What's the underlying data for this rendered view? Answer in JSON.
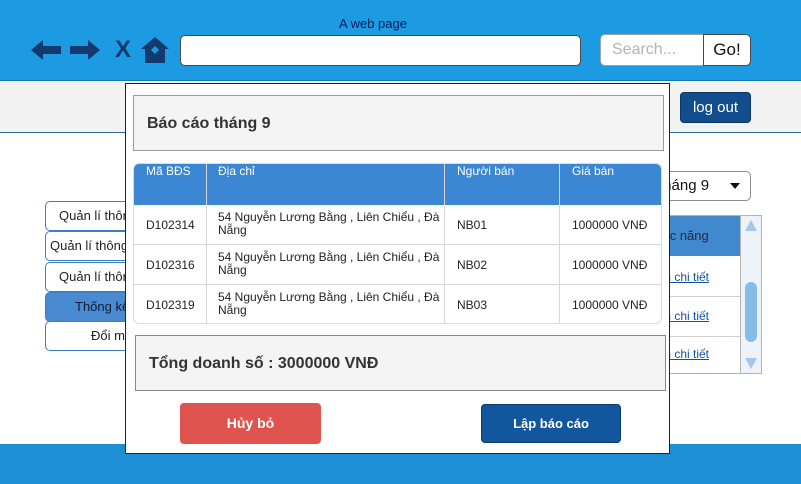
{
  "browser": {
    "page_title": "A web page",
    "url": "",
    "search_placeholder": "Search...",
    "go_label": "Go!",
    "icons": {
      "back": "arrow-left-icon",
      "forward": "arrow-right-icon",
      "stop": "close-icon",
      "home": "home-icon"
    },
    "stop_glyph": "X"
  },
  "header": {
    "logout_label": "log out"
  },
  "sidebar": {
    "items": [
      {
        "label": "Quản lí thôn"
      },
      {
        "label": "Quản lí thông"
      },
      {
        "label": "Quản lí thôn"
      },
      {
        "label": "Thống kê"
      },
      {
        "label": "Đổi mậ"
      }
    ],
    "active_index": 3
  },
  "background_panel": {
    "month_select_value": "tháng 9",
    "table_header": "ức năng",
    "links": [
      "m chi tiết",
      "m chi tiết",
      "m chi tiết"
    ]
  },
  "modal": {
    "title": "Báo cáo tháng 9",
    "columns": [
      "Mã BĐS",
      "Địa chỉ",
      "Người bán",
      "Giá bán"
    ],
    "rows": [
      {
        "code": "D102314",
        "address": "54 Nguyễn Lương Bằng , Liên Chiểu , Đà Nẵng",
        "seller": "NB01",
        "price": "1000000 VNĐ"
      },
      {
        "code": "D102316",
        "address": "54 Nguyễn Lương Bằng , Liên Chiểu , Đà Nẵng",
        "seller": "NB02",
        "price": "1000000 VNĐ"
      },
      {
        "code": "D102319",
        "address": "54 Nguyễn Lương Bằng , Liên Chiểu , Đà Nẵng",
        "seller": "NB03",
        "price": "1000000 VNĐ"
      }
    ],
    "total_text": "Tổng doanh số : 3000000 VNĐ",
    "cancel_label": "Hủy bỏ",
    "create_label": "Lập báo cáo"
  },
  "colors": {
    "chrome": "#1d9be2",
    "primary_button": "#12569d",
    "cancel_button": "#e0544f",
    "table_header": "#3c87d3"
  }
}
